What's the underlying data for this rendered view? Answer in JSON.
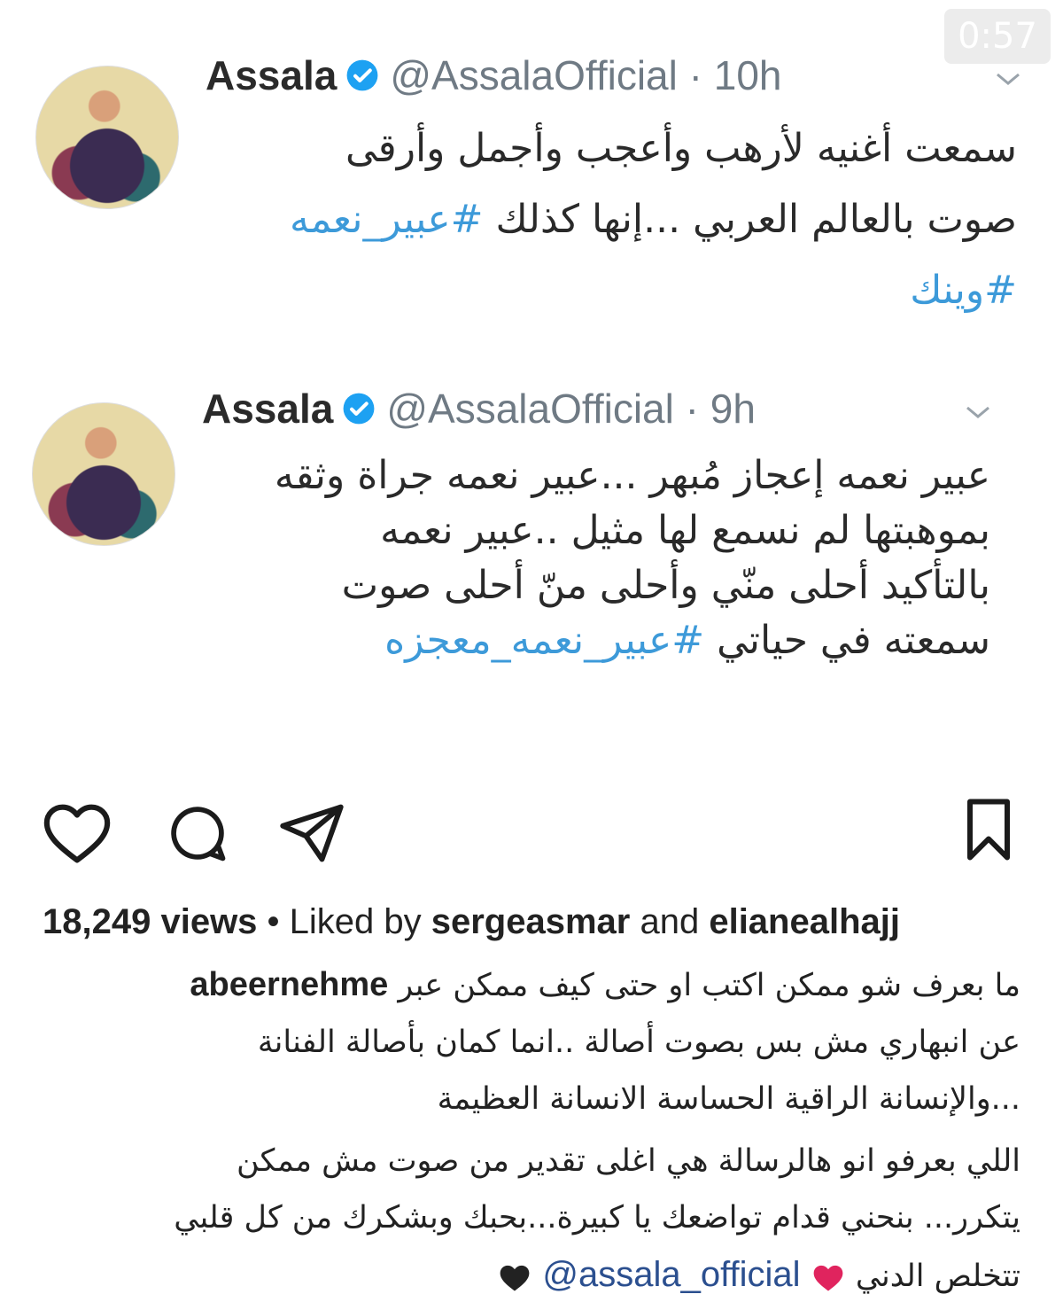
{
  "video": {
    "timer": "0:57"
  },
  "tweets": [
    {
      "name": "Assala",
      "handle_time": "@AssalaOfficial · 10h",
      "lines": [
        {
          "text": "سمعت أغنيه لأرهب وأعجب وأجمل وأرقى",
          "tag": ""
        },
        {
          "text": "صوت بالعالم العربي ...إنها كذلك ",
          "tag": "#عبير_نعمه"
        },
        {
          "text": "",
          "tag": "#وينك"
        }
      ]
    },
    {
      "name": "Assala",
      "handle_time": "@AssalaOfficial · 9h",
      "lines": [
        {
          "text": "عبير نعمه إعجاز مُبهر ...عبير نعمه جراة وثقه",
          "tag": ""
        },
        {
          "text": "بموهبتها لم نسمع لها مثيل ..عبير نعمه",
          "tag": ""
        },
        {
          "text": "بالتأكيد أحلى منّي وأحلى منّ أحلى صوت",
          "tag": ""
        },
        {
          "text": "سمعته في حياتي ",
          "tag": "#عبير_نعمه_معجزه"
        }
      ]
    }
  ],
  "post": {
    "views": "18,249 views",
    "liked_by_prefix": " • Liked by ",
    "liker1": "sergeasmar",
    "and": " and ",
    "liker2": "elianealhajj",
    "caption_user": "abeernehme",
    "caption_lines": [
      "ما بعرف شو ممكن اكتب او حتى كيف ممكن عبر",
      "عن انبهاري مش بس بصوت أصالة ..انما كمان بأصالة الفنانة",
      "...والإنسانة الراقية الحساسة الانسانة العظيمة",
      "اللي بعرفو انو هالرسالة هي اغلى تقدير من صوت مش ممكن",
      "يتكرر... بنحني قدام تواضعك يا كبيرة...بحبك وبشكرك من كل قلبي",
      "تتخلص الدني"
    ],
    "mention": "@assala_official",
    "colors": {
      "hashtag": "#3d9ad9",
      "mention": "#2b4f8f",
      "verified": "#1da1f2"
    }
  }
}
